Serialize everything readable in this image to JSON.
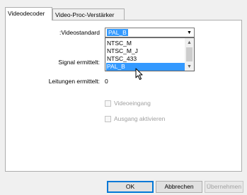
{
  "tabs": [
    {
      "label": "Videodecoder",
      "active": true
    },
    {
      "label": "Video-Proc-Verstärker",
      "active": false
    }
  ],
  "form": {
    "videostandard_label": ":Videostandard",
    "videostandard_value": "PAL_B",
    "signal_label": "Signal ermittelt:",
    "leitungen_label": "Leitungen ermittelt:",
    "leitungen_value": "0"
  },
  "dropdown": {
    "options": [
      "NTSC_M",
      "NTSC_M_J",
      "NTSC_433",
      "PAL_B"
    ],
    "selected": "PAL_B"
  },
  "checkboxes": {
    "videoeingang": {
      "label": "Videoeingang",
      "checked": false,
      "enabled": false
    },
    "ausgang": {
      "label": "Ausgang aktivieren",
      "checked": false,
      "enabled": false
    }
  },
  "buttons": {
    "ok": "OK",
    "cancel": "Abbrechen",
    "apply": "Übernehmen"
  },
  "colors": {
    "selection": "#3399ff",
    "default_button_border": "#0078d7"
  }
}
